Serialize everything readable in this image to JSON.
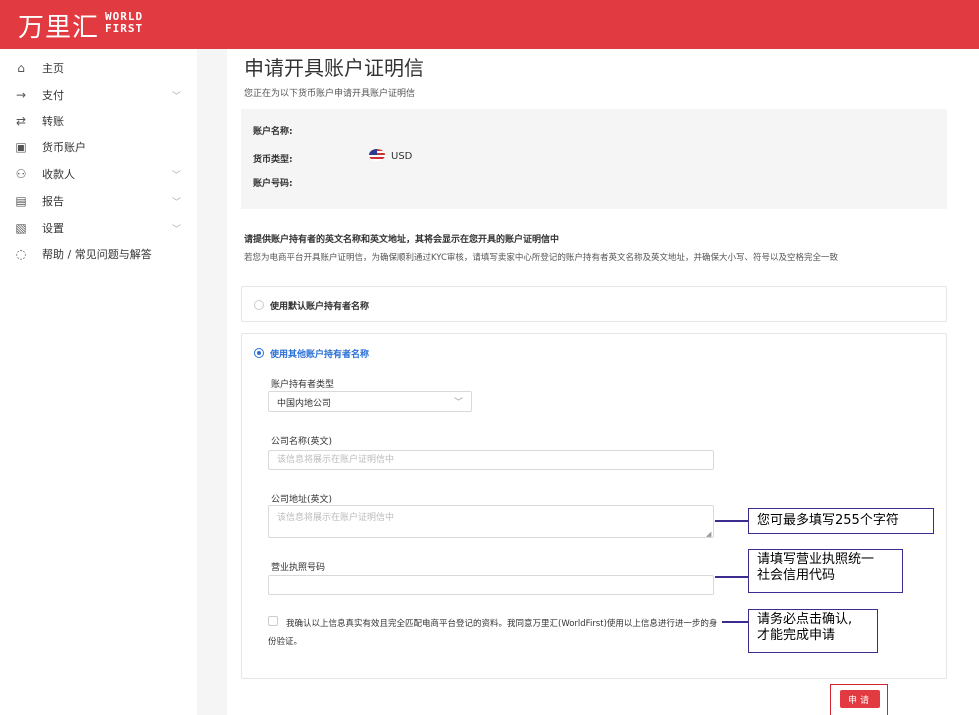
{
  "brand": {
    "name_cn": "万里汇",
    "name_en_line1": "WORLD",
    "name_en_line2": "FIRST",
    "color": "#e23a41"
  },
  "sidebar": {
    "items": [
      {
        "label": "主页",
        "icon": "home-icon",
        "has_children": false
      },
      {
        "label": "支付",
        "icon": "arrow-right-icon",
        "has_children": true
      },
      {
        "label": "转账",
        "icon": "swap-icon",
        "has_children": false
      },
      {
        "label": "货币账户",
        "icon": "wallet-icon",
        "has_children": false
      },
      {
        "label": "收款人",
        "icon": "users-icon",
        "has_children": true
      },
      {
        "label": "报告",
        "icon": "document-icon",
        "has_children": true
      },
      {
        "label": "设置",
        "icon": "settings-icon",
        "has_children": true
      },
      {
        "label": "帮助 / 常见问题与解答",
        "icon": "help-chat-icon",
        "has_children": false
      }
    ]
  },
  "page": {
    "title": "申请开具账户证明信",
    "subtitle": "您正在为以下货币账户申请开具账户证明信"
  },
  "account_info": {
    "name_label": "账户名称:",
    "currency_label": "货币类型:",
    "currency_value": "USD",
    "currency_flag": "us-flag-icon",
    "number_label": "账户号码:"
  },
  "notice": {
    "title": "请提供账户持有者的英文名称和英文地址，其将会显示在您开具的账户证明信中",
    "description": "若您为电商平台开具账户证明信，为确保顺利通过KYC审核，请填写卖家中心所登记的账户持有者英文名称及英文地址，并确保大小写、符号以及空格完全一致"
  },
  "options": {
    "default_holder": {
      "label": "使用默认账户持有者名称",
      "selected": false
    },
    "other_holder": {
      "label": "使用其他账户持有者名称",
      "selected": true
    }
  },
  "form": {
    "holder_type_label": "账户持有者类型",
    "holder_type_value": "中国内地公司",
    "company_name_label": "公司名称(英文)",
    "company_name_placeholder": "该信息将展示在账户证明信中",
    "company_address_label": "公司地址(英文)",
    "company_address_placeholder": "该信息将展示在账户证明信中",
    "license_label": "营业执照号码",
    "license_placeholder": "",
    "agree_text": "我确认以上信息真实有效且完全匹配电商平台登记的资料。我同意万里汇(WorldFirst)使用以上信息进行进一步的身份验证。",
    "agreed": false,
    "submit_label": "申请"
  },
  "annotations": {
    "address_hint": "您可最多填写255个字符",
    "license_hint_line1": "请填写营业执照统一",
    "license_hint_line2": "社会信用代码",
    "agree_hint_line1": "请务必点击确认,",
    "agree_hint_line2": "才能完成申请",
    "callout_color": "#3a2d8f",
    "highlight_color": "#d42430"
  }
}
